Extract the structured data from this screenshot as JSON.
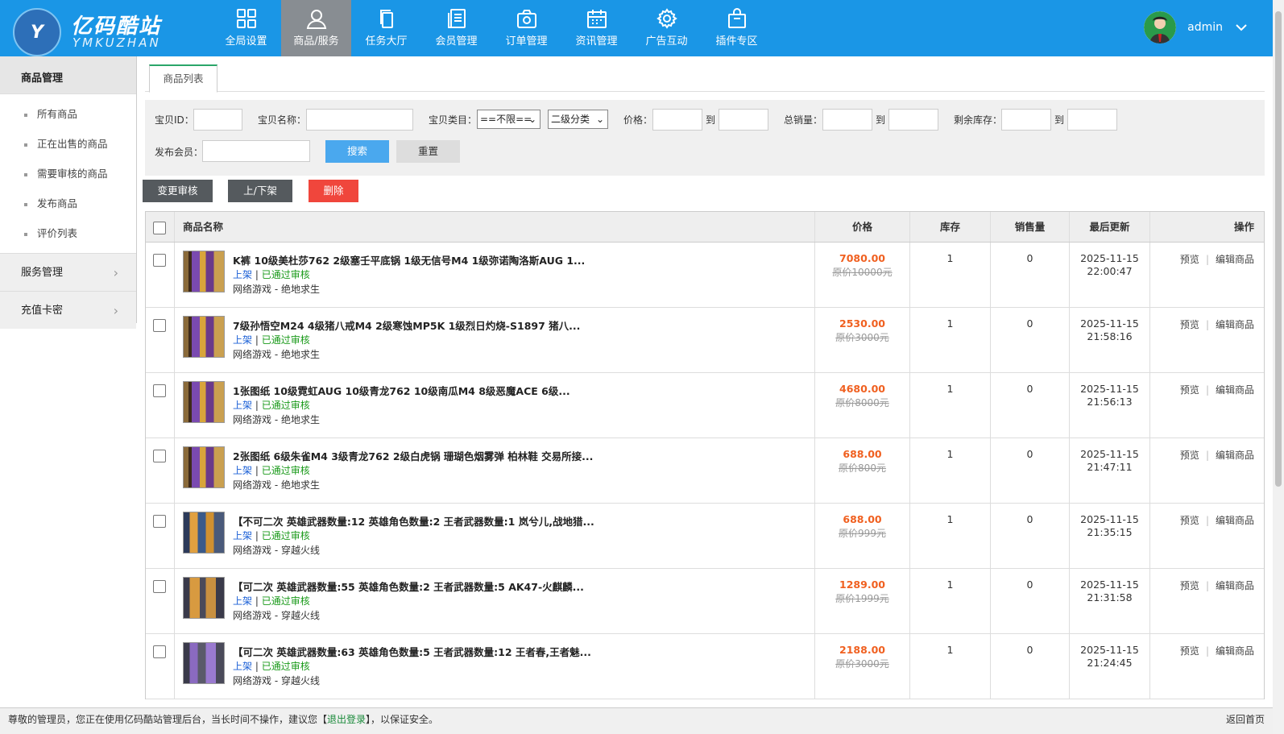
{
  "brand": {
    "cn": "亿码酷站",
    "en": "YMKUZHAN"
  },
  "nav": [
    {
      "label": "全局设置",
      "icon": "grid-icon"
    },
    {
      "label": "商品/服务",
      "icon": "user-icon"
    },
    {
      "label": "任务大厅",
      "icon": "copy-icon"
    },
    {
      "label": "会员管理",
      "icon": "list-icon"
    },
    {
      "label": "订单管理",
      "icon": "camera-icon"
    },
    {
      "label": "资讯管理",
      "icon": "calendar-icon"
    },
    {
      "label": "广告互动",
      "icon": "gear-icon"
    },
    {
      "label": "插件专区",
      "icon": "bag-icon"
    }
  ],
  "user": {
    "name": "admin"
  },
  "sidebar": {
    "title": "商品管理",
    "items": [
      "所有商品",
      "正在出售的商品",
      "需要审核的商品",
      "发布商品",
      "评价列表"
    ],
    "groups": [
      "服务管理",
      "充值卡密"
    ]
  },
  "tab": "商品列表",
  "filters": {
    "id_label": "宝贝ID：",
    "name_label": "宝贝名称：",
    "cat_label": "宝贝类目：",
    "cat_value": "==不限==",
    "cat2_value": "二级分类",
    "price_label": "价格：",
    "to": "到",
    "sales_label": "总销量：",
    "stock_label": "剩余库存：",
    "member_label": "发布会员：",
    "search": "搜索",
    "reset": "重置"
  },
  "actions": {
    "audit": "变更审核",
    "shelf": "上/下架",
    "delete": "删除"
  },
  "table": {
    "headers": [
      "商品名称",
      "价格",
      "库存",
      "销售量",
      "最后更新",
      "操作"
    ],
    "rows": [
      {
        "name": "K裤 10级美杜莎762 2级塞壬平底锅 1级无信号M4 1级弥诺陶洛斯AUG 1...",
        "on": "上架",
        "status": "已通过审核",
        "cat": "网络游戏 - 绝地求生",
        "price": "7080.00",
        "oprice": "原价10000元",
        "stock": "1",
        "sales": "0",
        "date": "2025-11-15",
        "time": "22:00:47"
      },
      {
        "name": "7级孙悟空M24 4级猪八戒M4 2级寒蚀MP5K 1级烈日灼烧-S1897 猪八...",
        "on": "上架",
        "status": "已通过审核",
        "cat": "网络游戏 - 绝地求生",
        "price": "2530.00",
        "oprice": "原价3000元",
        "stock": "1",
        "sales": "0",
        "date": "2025-11-15",
        "time": "21:58:16"
      },
      {
        "name": "1张图纸 10级霓虹AUG 10级青龙762 10级南瓜M4 8级恶魔ACE 6级...",
        "on": "上架",
        "status": "已通过审核",
        "cat": "网络游戏 - 绝地求生",
        "price": "4680.00",
        "oprice": "原价8000元",
        "stock": "1",
        "sales": "0",
        "date": "2025-11-15",
        "time": "21:56:13"
      },
      {
        "name": "2张图纸 6级朱雀M4 3级青龙762 2级白虎锅 珊瑚色烟雾弹 柏林鞋 交易所接...",
        "on": "上架",
        "status": "已通过审核",
        "cat": "网络游戏 - 绝地求生",
        "price": "688.00",
        "oprice": "原价800元",
        "stock": "1",
        "sales": "0",
        "date": "2025-11-15",
        "time": "21:47:11"
      },
      {
        "name": "【不可二次 英雄武器数量:12 英雄角色数量:2 王者武器数量:1 岚兮儿,战地猎...",
        "on": "上架",
        "status": "已通过审核",
        "cat": "网络游戏 - 穿越火线",
        "price": "688.00",
        "oprice": "原价999元",
        "stock": "1",
        "sales": "0",
        "date": "2025-11-15",
        "time": "21:35:15"
      },
      {
        "name": "【可二次 英雄武器数量:55 英雄角色数量:2 王者武器数量:5 AK47-火麒麟...",
        "on": "上架",
        "status": "已通过审核",
        "cat": "网络游戏 - 穿越火线",
        "price": "1289.00",
        "oprice": "原价1999元",
        "stock": "1",
        "sales": "0",
        "date": "2025-11-15",
        "time": "21:31:58"
      },
      {
        "name": "【可二次 英雄武器数量:63 英雄角色数量:5 王者武器数量:12 王者春,王者魅...",
        "on": "上架",
        "status": "已通过审核",
        "cat": "网络游戏 - 穿越火线",
        "price": "2188.00",
        "oprice": "原价3000元",
        "stock": "1",
        "sales": "0",
        "date": "2025-11-15",
        "time": "21:24:45"
      }
    ],
    "ops": {
      "preview": "预览",
      "edit": "编辑商品"
    }
  },
  "footer": {
    "pre": "尊敬的管理员，您正在使用亿码酷站管理后台，当长时间不操作，建议您【",
    "logout": "退出登录",
    "post": "】，以保证安全。",
    "home": "返回首页"
  },
  "colors": {
    "topbar": "#1a96e6",
    "active_nav": "#888d92",
    "search": "#4aa8ee",
    "delete": "#f0463c",
    "dark_btn": "#555a5e",
    "price": "#f06020"
  }
}
